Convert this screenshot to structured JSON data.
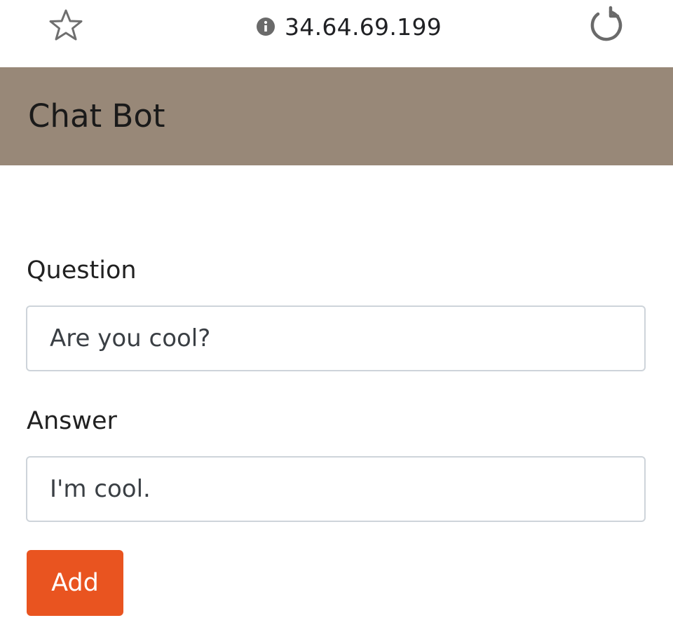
{
  "browser": {
    "url": "34.64.69.199",
    "icons": {
      "bookmark": "star-icon",
      "site_info": "info-icon",
      "reload": "reload-icon"
    }
  },
  "header": {
    "title": "Chat Bot",
    "background_color": "#988878"
  },
  "form": {
    "question": {
      "label": "Question",
      "value": "Are you cool?"
    },
    "answer": {
      "label": "Answer",
      "value": "I'm cool."
    },
    "submit": {
      "label": "Add",
      "color": "#e95420"
    }
  }
}
